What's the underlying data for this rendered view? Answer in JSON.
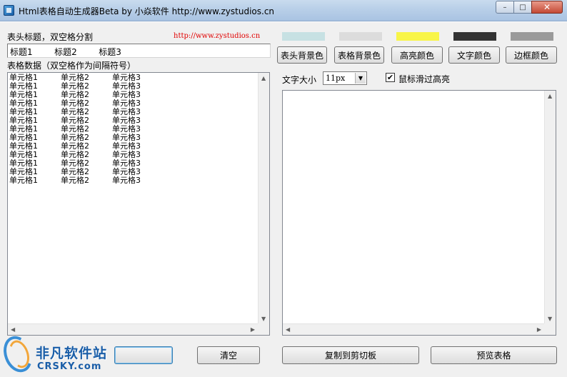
{
  "window": {
    "title": "Html表格自动生成器Beta    by 小焱软件 http://www.zystudios.cn",
    "min_symbol": "–",
    "max_symbol": "□",
    "close_symbol": "✕"
  },
  "header": {
    "label": "表头标题，双空格分割",
    "link": "http://www.zystudios.cn",
    "value": "标题1        标题2        标题3"
  },
  "table_data": {
    "label": "表格数据（双空格作为间隔符号）",
    "rows": [
      [
        "单元格1",
        "单元格2",
        "单元格3"
      ],
      [
        "单元格1",
        "单元格2",
        "单元格3"
      ],
      [
        "单元格1",
        "单元格2",
        "单元格3"
      ],
      [
        "单元格1",
        "单元格2",
        "单元格3"
      ],
      [
        "单元格1",
        "单元格2",
        "单元格3"
      ],
      [
        "单元格1",
        "单元格2",
        "单元格3"
      ],
      [
        "单元格1",
        "单元格2",
        "单元格3"
      ],
      [
        "单元格1",
        "单元格2",
        "单元格3"
      ],
      [
        "单元格1",
        "单元格2",
        "单元格3"
      ],
      [
        "单元格1",
        "单元格2",
        "单元格3"
      ],
      [
        "单元格1",
        "单元格2",
        "单元格3"
      ],
      [
        "单元格1",
        "单元格2",
        "单元格3"
      ],
      [
        "单元格1",
        "单元格2",
        "单元格3"
      ]
    ]
  },
  "colors": {
    "header_bg": "#c7e1e3",
    "table_bg": "#dcdcdc",
    "highlight": "#f8f548",
    "text": "#333333",
    "border": "#9a9a9a"
  },
  "color_buttons": {
    "header_bg": "表头背景色",
    "table_bg": "表格背景色",
    "highlight": "高亮颜色",
    "text": "文字颜色",
    "border": "边框颜色"
  },
  "font_size": {
    "label": "文字大小",
    "value": "11px"
  },
  "hover_highlight": {
    "label": "鼠标滑过高亮",
    "checked": true,
    "check_symbol": "✔"
  },
  "actions": {
    "clear": "清空",
    "copy": "复制到剪切板",
    "preview": "预览表格"
  },
  "scroll_arrows": {
    "up": "▲",
    "down": "▼",
    "left": "◀",
    "right": "▶"
  },
  "watermark": {
    "cn": "非凡软件站",
    "en": "CRSKY.com"
  }
}
